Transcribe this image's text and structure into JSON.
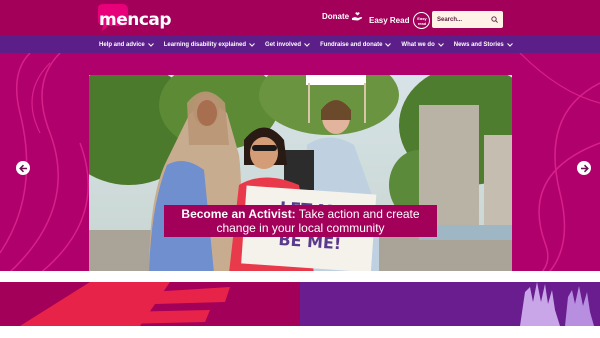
{
  "header": {
    "logo_text": "mencap",
    "donate_label": "Donate",
    "easyread_label": "Easy Read",
    "easyread_badge_line1": "Easy",
    "easyread_badge_line2": "read",
    "search_placeholder": "Search..."
  },
  "nav": {
    "items": [
      {
        "label": "Help and advice"
      },
      {
        "label": "Learning disability explained"
      },
      {
        "label": "Get involved"
      },
      {
        "label": "Fundraise and donate"
      },
      {
        "label": "What we do"
      },
      {
        "label": "News and Stories"
      }
    ]
  },
  "hero": {
    "caption_bold": "Become an Activist:",
    "caption_rest": " Take action and create change in your local community",
    "sign_text": "LET ME BE ME!"
  },
  "colors": {
    "brand_magenta": "#a3005a",
    "nav_purple": "#5c1f8a",
    "logo_pink": "#e8007a",
    "search_bg": "#fff2e6"
  }
}
